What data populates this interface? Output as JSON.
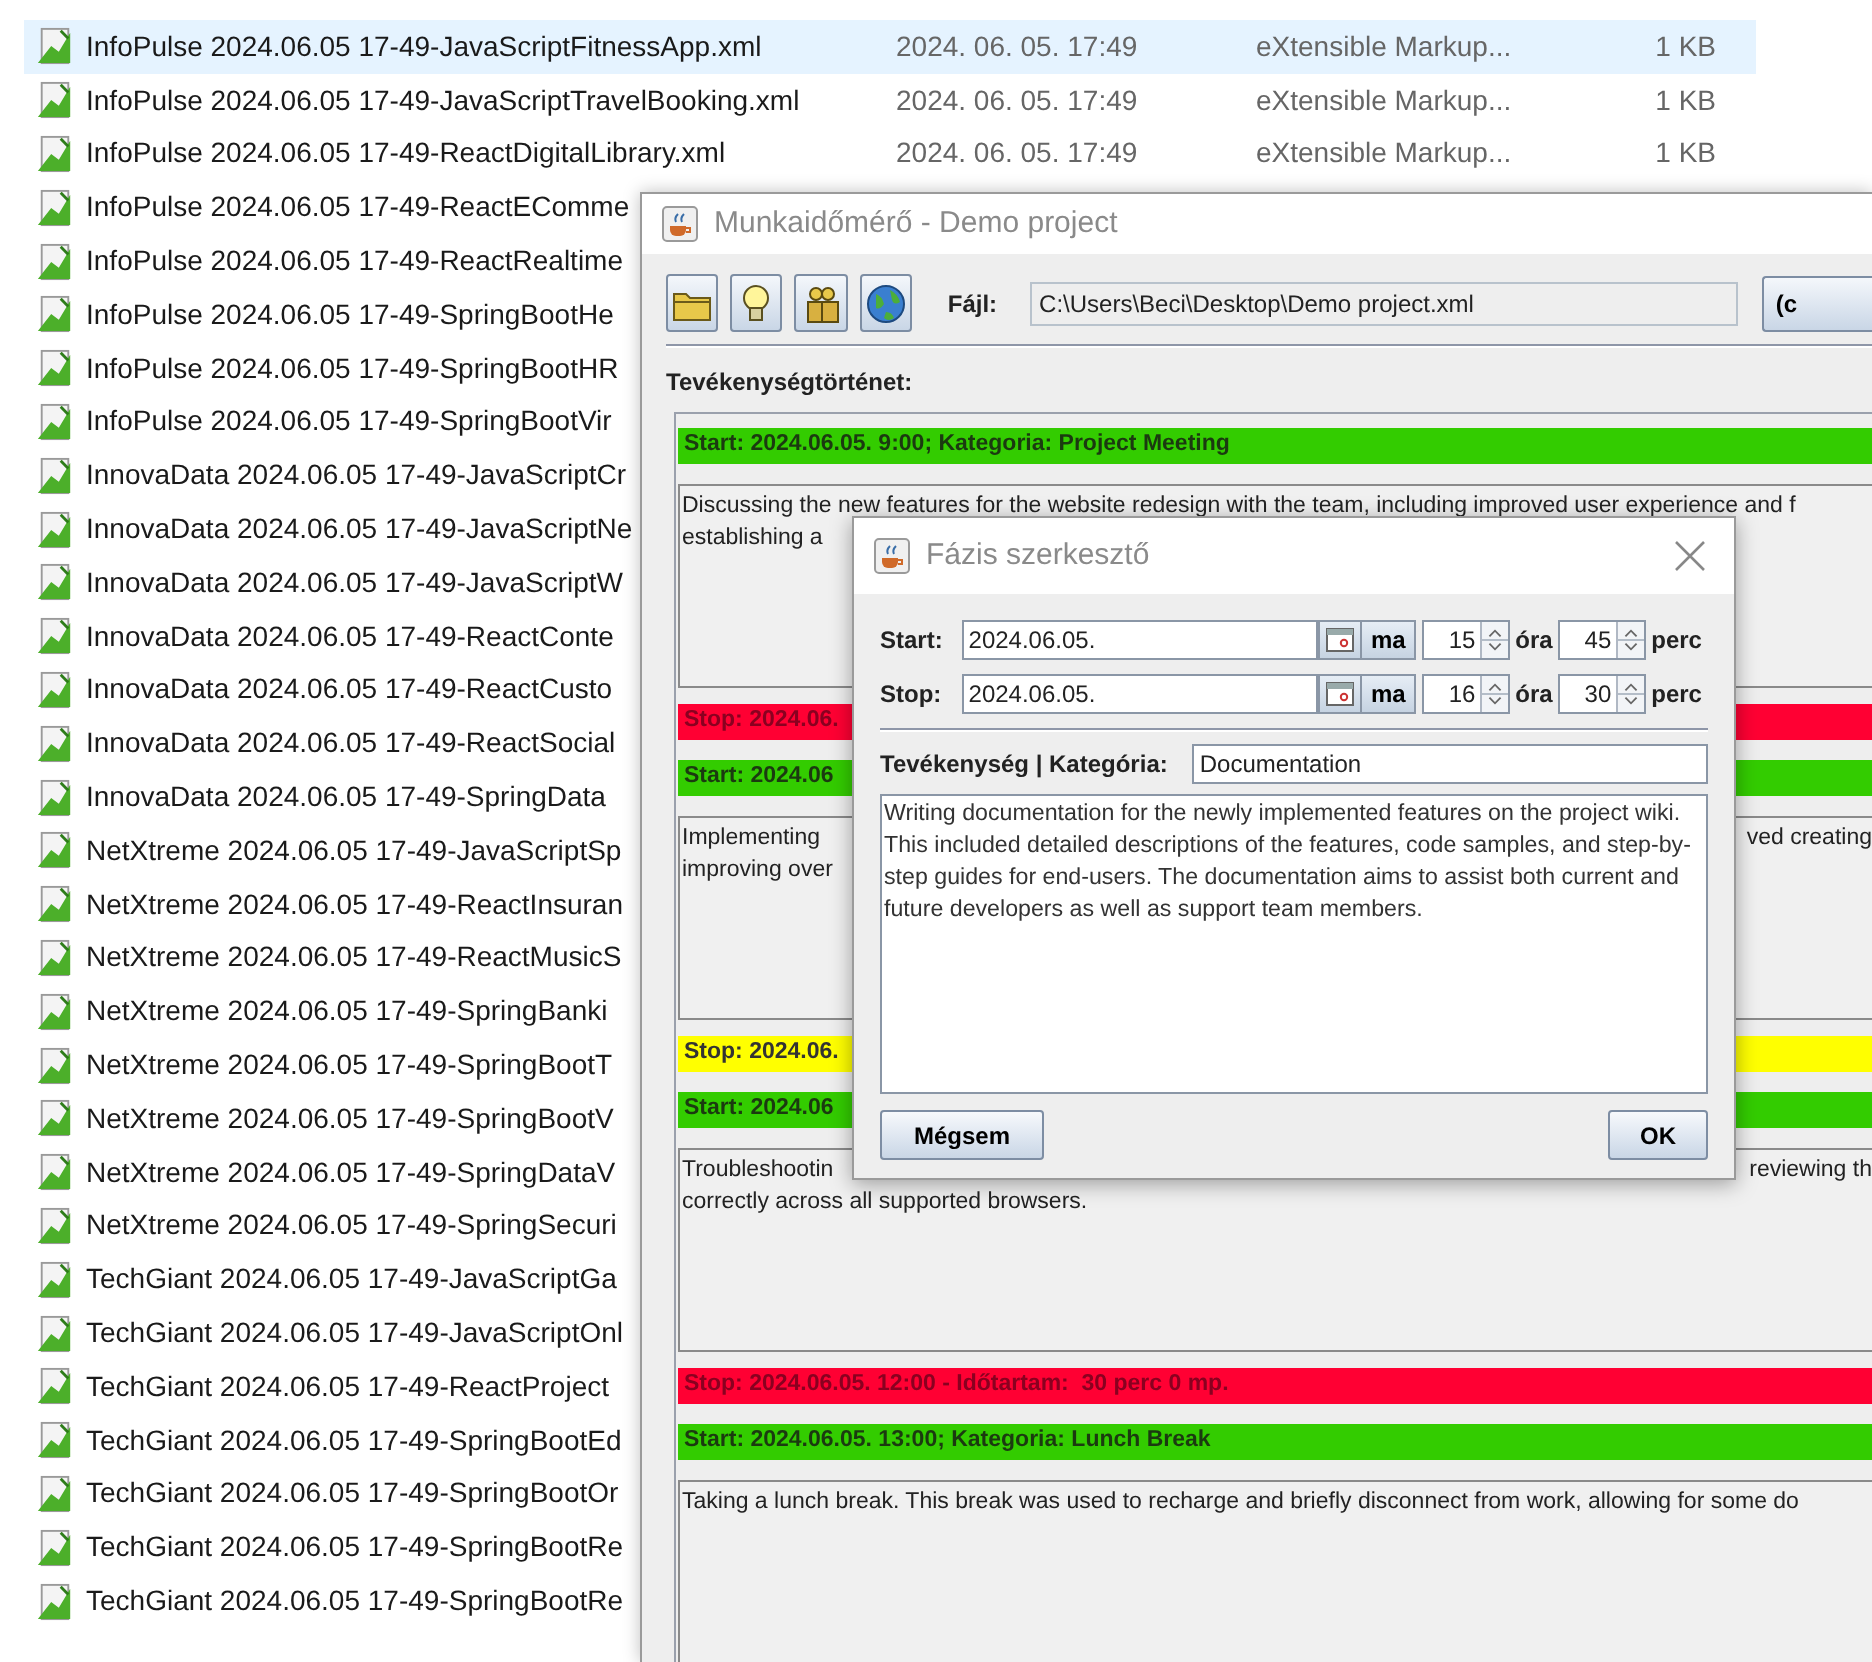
{
  "explorer": {
    "files": [
      {
        "name": "InfoPulse 2024.06.05 17-49-JavaScriptFitnessApp.xml",
        "date": "2024. 06. 05. 17:49",
        "type": "eXtensible Markup...",
        "size": "1 KB",
        "selected": true
      },
      {
        "name": "InfoPulse 2024.06.05 17-49-JavaScriptTravelBooking.xml",
        "date": "2024. 06. 05. 17:49",
        "type": "eXtensible Markup...",
        "size": "1 KB",
        "selected": false
      },
      {
        "name": "InfoPulse 2024.06.05 17-49-ReactDigitalLibrary.xml",
        "date": "2024. 06. 05. 17:49",
        "type": "eXtensible Markup...",
        "size": "1 KB",
        "selected": false
      },
      {
        "name": "InfoPulse 2024.06.05 17-49-ReactEComme",
        "selected": false
      },
      {
        "name": "InfoPulse 2024.06.05 17-49-ReactRealtime",
        "selected": false
      },
      {
        "name": "InfoPulse 2024.06.05 17-49-SpringBootHe",
        "selected": false
      },
      {
        "name": "InfoPulse 2024.06.05 17-49-SpringBootHR",
        "selected": false
      },
      {
        "name": "InfoPulse 2024.06.05 17-49-SpringBootVir",
        "selected": false
      },
      {
        "name": "InnovaData 2024.06.05 17-49-JavaScriptCr",
        "selected": false
      },
      {
        "name": "InnovaData 2024.06.05 17-49-JavaScriptNe",
        "selected": false
      },
      {
        "name": "InnovaData 2024.06.05 17-49-JavaScriptW",
        "selected": false
      },
      {
        "name": "InnovaData 2024.06.05 17-49-ReactConte",
        "selected": false
      },
      {
        "name": "InnovaData 2024.06.05 17-49-ReactCusto",
        "selected": false
      },
      {
        "name": "InnovaData 2024.06.05 17-49-ReactSocial",
        "selected": false
      },
      {
        "name": "InnovaData 2024.06.05 17-49-SpringData",
        "selected": false
      },
      {
        "name": "NetXtreme 2024.06.05 17-49-JavaScriptSp",
        "selected": false
      },
      {
        "name": "NetXtreme 2024.06.05 17-49-ReactInsuran",
        "selected": false
      },
      {
        "name": "NetXtreme 2024.06.05 17-49-ReactMusicS",
        "selected": false
      },
      {
        "name": "NetXtreme 2024.06.05 17-49-SpringBanki",
        "selected": false
      },
      {
        "name": "NetXtreme 2024.06.05 17-49-SpringBootT",
        "selected": false
      },
      {
        "name": "NetXtreme 2024.06.05 17-49-SpringBootV",
        "selected": false
      },
      {
        "name": "NetXtreme 2024.06.05 17-49-SpringDataV",
        "selected": false
      },
      {
        "name": "NetXtreme 2024.06.05 17-49-SpringSecuri",
        "selected": false
      },
      {
        "name": "TechGiant 2024.06.05 17-49-JavaScriptGa",
        "selected": false
      },
      {
        "name": "TechGiant 2024.06.05 17-49-JavaScriptOnl",
        "selected": false
      },
      {
        "name": "TechGiant 2024.06.05 17-49-ReactProject",
        "selected": false
      },
      {
        "name": "TechGiant 2024.06.05 17-49-SpringBootEd",
        "selected": false
      },
      {
        "name": "TechGiant 2024.06.05 17-49-SpringBootOr",
        "selected": false
      },
      {
        "name": "TechGiant 2024.06.05 17-49-SpringBootRe",
        "selected": false
      },
      {
        "name": "TechGiant 2024.06.05 17-49-SpringBootRe",
        "selected": false
      }
    ]
  },
  "main_window": {
    "title": "Munkaidőmérő - Demo project",
    "file_label": "Fájl:",
    "file_path": "C:\\Users\\Beci\\Desktop\\Demo project.xml",
    "button": "(c",
    "history_label": "Tevékenységtörténet:",
    "history": [
      {
        "kind": "bar",
        "color": "#33cc00",
        "text": "Start: 2024.06.05. 9:00; Kategoria: Project Meeting"
      },
      {
        "kind": "note",
        "lines": [
          {
            "left": "Discussing the new features for the website redesign with the team, including improved user experience and f"
          },
          {
            "left": "establishing a"
          }
        ]
      },
      {
        "kind": "bar",
        "color": "#ff0033",
        "text": "Stop: 2024.06."
      },
      {
        "kind": "bar",
        "color": "#33cc00",
        "text": "Start: 2024.06"
      },
      {
        "kind": "note",
        "lines": [
          {
            "left": "Implementing",
            "right": "ved creating"
          },
          {
            "left": "improving over"
          }
        ]
      },
      {
        "kind": "bar",
        "color": "#ffff00",
        "text": "Stop: 2024.06."
      },
      {
        "kind": "bar",
        "color": "#33cc00",
        "text": "Start: 2024.06"
      },
      {
        "kind": "note",
        "lines": [
          {
            "left": "Troubleshootin",
            "right": "reviewing th"
          },
          {
            "left": "correctly across all supported browsers."
          }
        ]
      },
      {
        "kind": "bar",
        "color": "#ff0033",
        "text": "Stop: 2024.06.05. 12:00 - Időtartam:  30 perc 0 mp."
      },
      {
        "kind": "bar",
        "color": "#33cc00",
        "text": "Start: 2024.06.05. 13:00; Kategoria: Lunch Break"
      },
      {
        "kind": "note",
        "lines": [
          {
            "left": "Taking a lunch break. This break was used to recharge and briefly disconnect from work, allowing for some do"
          }
        ]
      }
    ]
  },
  "dialog": {
    "title": "Fázis szerkesztő",
    "times": [
      {
        "label": "Start:",
        "date": "2024.06.05.",
        "today": "ma",
        "hour": "15",
        "hour_unit": "óra",
        "minute": "45",
        "minute_unit": "perc"
      },
      {
        "label": "Stop:",
        "date": "2024.06.05.",
        "today": "ma",
        "hour": "16",
        "hour_unit": "óra",
        "minute": "30",
        "minute_unit": "perc"
      }
    ],
    "category_label": "Tevékenység | Kategória:",
    "category": "Documentation",
    "description": "Writing documentation for the newly implemented features on the project wiki. This included detailed descriptions of the features, code samples, and step-by-step guides for end-users. The documentation aims to assist both current and future developers as well as support team members.",
    "cancel": "Mégsem",
    "ok": "OK"
  }
}
